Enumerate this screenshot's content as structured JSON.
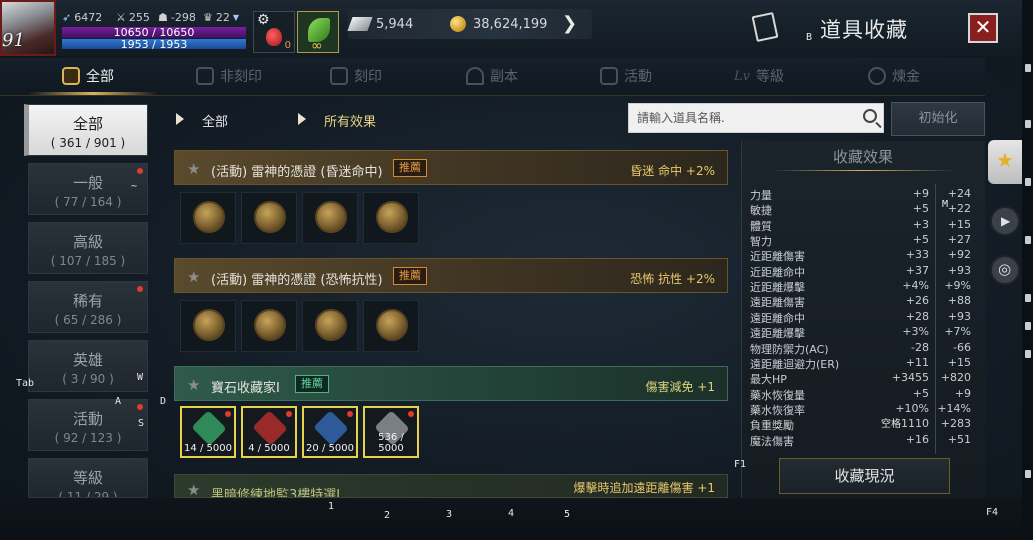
{
  "player": {
    "level": "91",
    "stat_attack": "6472",
    "stat_sword": "255",
    "stat_helmet": "-298",
    "stat_trophy": "22",
    "hp": "10650 / 10650",
    "mp": "1953 / 1953",
    "potion_count": "0",
    "slot_infinite": "∞"
  },
  "currency": {
    "silver": "5,944",
    "gold": "38,624,199"
  },
  "window": {
    "title": "道具收藏",
    "title_hotkey": "B",
    "close_label": "✕"
  },
  "tabs": [
    {
      "label": "全部",
      "active": true
    },
    {
      "label": "非刻印",
      "active": false
    },
    {
      "label": "刻印",
      "active": false
    },
    {
      "label": "副本",
      "active": false
    },
    {
      "label": "活動",
      "active": false
    },
    {
      "label": "等級",
      "active": false
    },
    {
      "label": "煉金",
      "active": false
    }
  ],
  "categories": [
    {
      "name": "全部",
      "count": "( 361 / 901 )",
      "active": true,
      "dot": false
    },
    {
      "name": "一般",
      "count": "( 77 / 164 )",
      "active": false,
      "dot": true
    },
    {
      "name": "高級",
      "count": "( 107 / 185 )",
      "active": false,
      "dot": false
    },
    {
      "name": "稀有",
      "count": "( 65 / 286 )",
      "active": false,
      "dot": true
    },
    {
      "name": "英雄",
      "count": "( 3 / 90 )",
      "active": false,
      "dot": false
    },
    {
      "name": "活動",
      "count": "( 92 / 123 )",
      "active": false,
      "dot": true
    },
    {
      "name": "等級",
      "count": "( 11 / 29 )",
      "active": false,
      "dot": false
    }
  ],
  "filters": {
    "category": "全部",
    "effect": "所有效果",
    "search_placeholder": "請輸入道具名稱.",
    "reset_label": "初始化"
  },
  "collections": [
    {
      "name": "(活動) 雷神的憑證 (昏迷命中)",
      "badge": "推薦",
      "effect": "昏迷 命中 +2%"
    },
    {
      "name": "(活動) 雷神的憑證 (恐怖抗性)",
      "badge": "推薦",
      "effect": "恐怖 抗性 +2%"
    },
    {
      "name": "寶石收藏家I",
      "badge": "推薦",
      "effect": "傷害減免 +1",
      "gems": [
        {
          "qty": "14 / 5000",
          "color": "#2f8a5a"
        },
        {
          "qty": "4 / 5000",
          "color": "#9a2a2a"
        },
        {
          "qty": "20 / 5000",
          "color": "#2f5a9a"
        },
        {
          "qty": "536 / 5000",
          "color": "#7a7f86"
        }
      ]
    },
    {
      "name": "黑暗修練地監3樓特選I",
      "badge": "",
      "effect": "爆擊時追加遠距離傷害 +1"
    }
  ],
  "panel": {
    "title": "收藏效果",
    "status_button": "收藏現況",
    "effects": [
      {
        "name": "力量",
        "val": "+9",
        "max": "+24"
      },
      {
        "name": "敏捷",
        "val": "+5",
        "max": "+22"
      },
      {
        "name": "體質",
        "val": "+3",
        "max": "+15"
      },
      {
        "name": "智力",
        "val": "+5",
        "max": "+27"
      },
      {
        "name": "近距離傷害",
        "val": "+33",
        "max": "+92"
      },
      {
        "name": "近距離命中",
        "val": "+37",
        "max": "+93"
      },
      {
        "name": "近距離爆擊",
        "val": "+4%",
        "max": "+9%"
      },
      {
        "name": "遠距離傷害",
        "val": "+26",
        "max": "+88"
      },
      {
        "name": "遠距離命中",
        "val": "+28",
        "max": "+93"
      },
      {
        "name": "遠距離爆擊",
        "val": "+3%",
        "max": "+7%"
      },
      {
        "name": "物理防禦力(AC)",
        "val": "-28",
        "max": "-66"
      },
      {
        "name": "遠距離迴避力(ER)",
        "val": "+11",
        "max": "+15"
      },
      {
        "name": "最大HP",
        "val": "+3455",
        "max": "+820"
      },
      {
        "name": "藥水恢復量",
        "val": "+5",
        "max": "+9"
      },
      {
        "name": "藥水恢復率",
        "val": "+10%",
        "max": "+14%"
      },
      {
        "name": "負重獎勵",
        "val": "1110",
        "max": "+283"
      },
      {
        "name": "魔法傷害",
        "val": "+16",
        "max": "+51"
      }
    ]
  },
  "keys": {
    "tab": "Tab",
    "w": "W",
    "a": "A",
    "s": "S",
    "d": "D",
    "m": "M",
    "tilde": "~",
    "f1": "F1",
    "f4": "F4",
    "space": "空格",
    "n1": "1",
    "n2": "2",
    "n3": "3",
    "n4": "4",
    "n5": "5"
  },
  "colors": {
    "accent_gold": "#d9b45a",
    "recommend_orange": "#e49a48",
    "recommend_green": "#5fd6a3",
    "close_red": "#8a1f1f"
  }
}
